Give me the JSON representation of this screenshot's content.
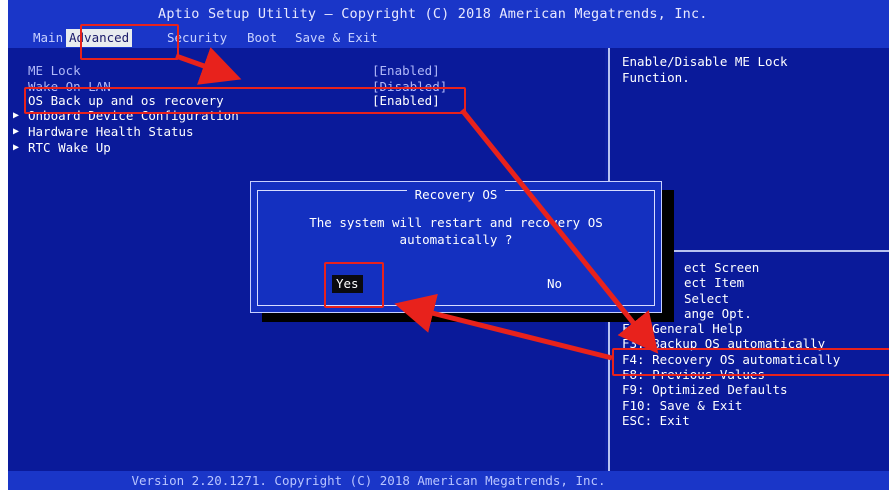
{
  "title": "Aptio Setup Utility – Copyright (C) 2018 American Megatrends, Inc.",
  "tabs": [
    {
      "label": "Main"
    },
    {
      "label": "Advanced"
    },
    {
      "label": "Security"
    },
    {
      "label": "Boot"
    },
    {
      "label": "Save & Exit"
    }
  ],
  "settings": [
    {
      "label": "ME Lock",
      "value": "[Enabled]"
    },
    {
      "label": "Wake On LAN",
      "value": "[Disabled]"
    },
    {
      "label": "OS Back up and os recovery",
      "value": "[Enabled]"
    }
  ],
  "submenus": [
    {
      "label": "Onboard Device Configuration"
    },
    {
      "label": "Hardware Health Status"
    },
    {
      "label": "RTC Wake Up"
    }
  ],
  "help": {
    "line1": "Enable/Disable ME Lock",
    "line2": "Function."
  },
  "keys": [
    "ect Screen",
    "ect Item",
    "Select",
    "ange Opt.",
    "F1: General Help",
    "F3: Backup OS automatically",
    "F4: Recovery OS automatically",
    "F8: Previous Values",
    "F9: Optimized Defaults",
    "F10: Save & Exit",
    "ESC: Exit"
  ],
  "dialog": {
    "title": "Recovery OS",
    "message_line1": "The system will restart and recovery OS",
    "message_line2": "automatically ?",
    "yes_label": "Yes",
    "no_label": "No"
  },
  "footer": "Version 2.20.1271. Copyright (C) 2018 American Megatrends, Inc.",
  "colors": {
    "background": "#0a1a9a",
    "titlebar": "#1a36c8",
    "annotation": "#e8221c"
  }
}
